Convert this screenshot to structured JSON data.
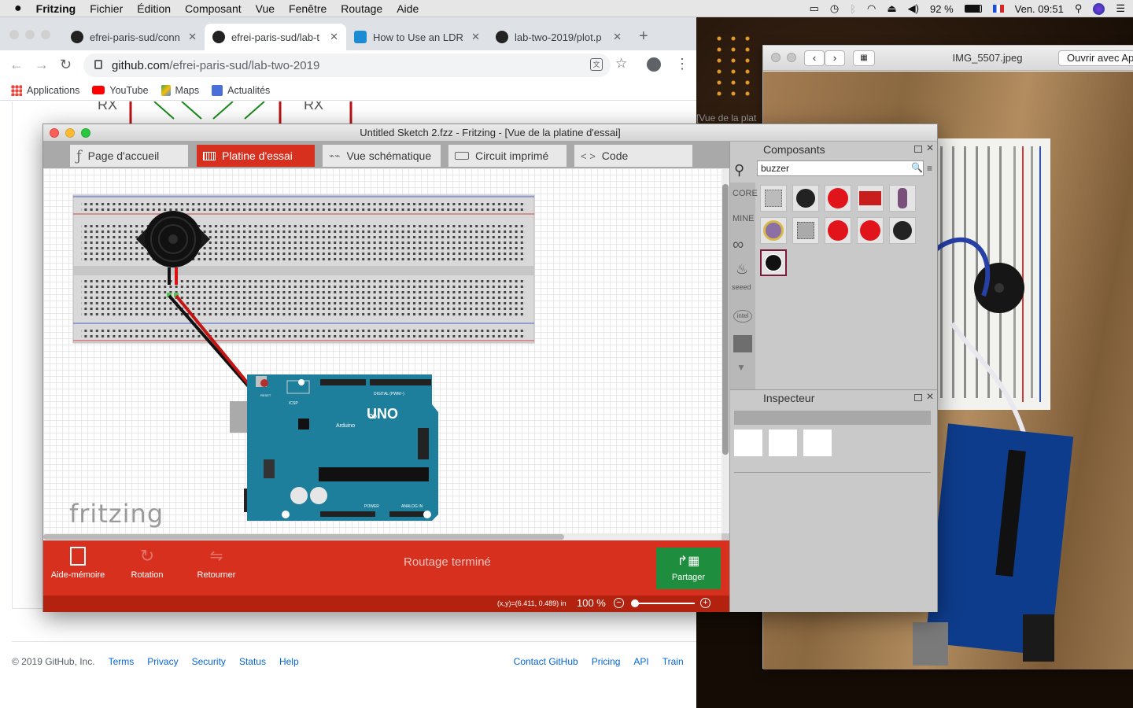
{
  "menubar": {
    "app": "Fritzing",
    "items": [
      "Fichier",
      "Édition",
      "Composant",
      "Vue",
      "Fenêtre",
      "Routage",
      "Aide"
    ],
    "battery": "92 %",
    "clock": "Ven. 09:51"
  },
  "preview": {
    "title": "IMG_5507.jpeg",
    "open_with": "Ouvrir avec Ap"
  },
  "chrome": {
    "tabs": [
      {
        "label": "efrei-paris-sud/conn",
        "active": false
      },
      {
        "label": "efrei-paris-sud/lab-t",
        "active": true
      },
      {
        "label": "How to Use an LDR",
        "active": false
      },
      {
        "label": "lab-two-2019/plot.p",
        "active": false
      }
    ],
    "url_host": "github.com",
    "url_path": "/efrei-paris-sud/lab-two-2019",
    "bookmarks": [
      "Applications",
      "YouTube",
      "Maps",
      "Actualités"
    ],
    "behind_text": "[Vue de la plat"
  },
  "footer": {
    "copyright": "© 2019 GitHub, Inc.",
    "left_links": [
      "Terms",
      "Privacy",
      "Security",
      "Status",
      "Help"
    ],
    "right_links": [
      "Contact GitHub",
      "Pricing",
      "API",
      "Train"
    ]
  },
  "fritzing": {
    "title": "Untitled Sketch 2.fzz - Fritzing - [Vue de la platine d'essai]",
    "tabs": [
      "Page d'accueil",
      "Platine d'essai",
      "Vue schématique",
      "Circuit imprimé",
      "Code"
    ],
    "active_tab": 1,
    "watermark": "fritzing",
    "toolbar": {
      "notes": "Aide-mémoire",
      "rotate": "Rotation",
      "flip": "Retourner",
      "routing_status": "Routage terminé",
      "share": "Partager"
    },
    "status": {
      "coords": "(x,y)=(6.411, 0.489) in",
      "zoom": "100 %"
    },
    "parts_panel": {
      "title": "Composants",
      "search_value": "buzzer",
      "bins": [
        "CORE",
        "MINE"
      ]
    },
    "inspector": {
      "title": "Inspecteur"
    },
    "board_labels": {
      "uno": "UNO",
      "arduino": "Arduino",
      "icsp": "ICSP",
      "reset": "RESET",
      "digital": "DIGITAL (PWM~)",
      "power": "POWER",
      "analog": "ANALOG IN"
    }
  }
}
